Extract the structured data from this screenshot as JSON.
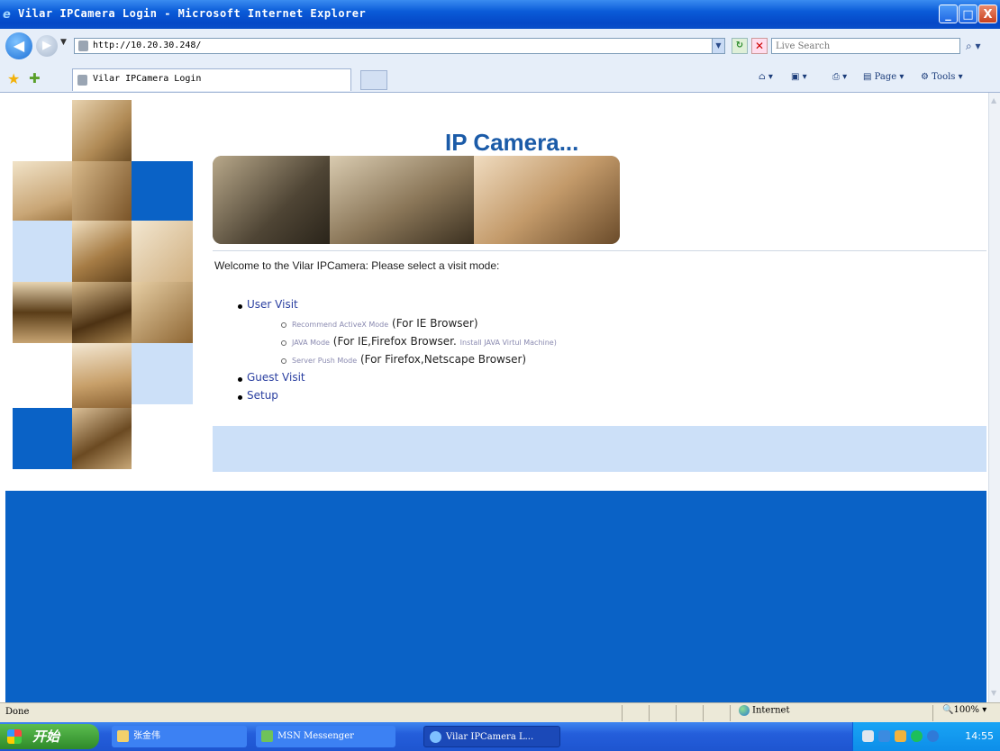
{
  "window": {
    "title": "Vilar IPCamera Login - Microsoft Internet Explorer",
    "controls": {
      "minimize": "_",
      "maximize": "□",
      "close": "X"
    }
  },
  "address_bar": {
    "url": "http://10.20.30.248/",
    "search_placeholder": "Live Search"
  },
  "favorites_bar": {
    "tab_title": "Vilar IPCamera Login",
    "page_menu": "Page",
    "tools_menu": "Tools"
  },
  "page": {
    "header_title": "IP Camera...",
    "welcome": "Welcome to the Vilar IPCamera: Please select a visit mode:",
    "user_visit": "User Visit",
    "modes": [
      {
        "link": "Recommend ActiveX Mode",
        "desc": "(For IE Browser)"
      },
      {
        "link": "JAVA Mode",
        "desc": "(For IE,Firefox Browser.",
        "extra": "Install JAVA Virtul Machine)"
      },
      {
        "link": "Server Push Mode",
        "desc": "(For Firefox,Netscape Browser)"
      }
    ],
    "guest_visit": "Guest Visit",
    "setup": "Setup"
  },
  "colors": {
    "mosaic_blue": "#0a62c6",
    "mosaic_light": "#cce0f8",
    "link": "#2a3fa0",
    "header_blue": "#1b5ba8"
  },
  "status_bar": {
    "text": "Done",
    "zone": "Internet",
    "zoom": "100%"
  },
  "taskbar": {
    "start": "开始",
    "items": [
      "张金伟",
      "MSN Messenger",
      "Vilar IPCamera L..."
    ],
    "clock": "14:55"
  },
  "icons": {
    "back": "back-arrow-icon",
    "forward": "forward-arrow-icon",
    "page": "page-icon",
    "refresh": "refresh-icon",
    "stop": "stop-icon",
    "search": "search-icon",
    "favorites": "favorites-star-icon",
    "add_favorites": "add-favorites-icon",
    "home": "home-icon",
    "feeds": "feeds-icon",
    "print": "print-icon",
    "globe": "globe-icon"
  }
}
